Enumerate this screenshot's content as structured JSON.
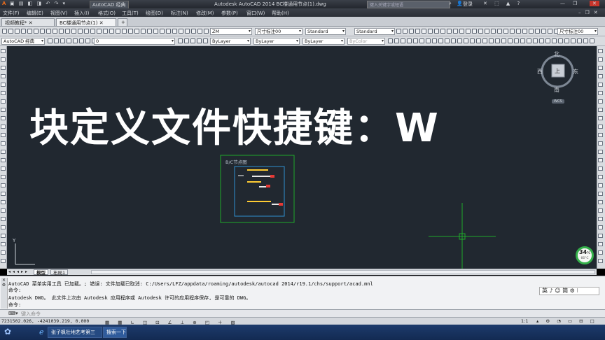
{
  "titlebar": {
    "workspace": "AutoCAD 经典",
    "title": "Autodesk AutoCAD 2014    BC楼通用节点(1).dwg",
    "search_placeholder": "键入关键字或短语",
    "login": "登录",
    "help": "?"
  },
  "menu": [
    "文件(F)",
    "编辑(E)",
    "视图(V)",
    "插入(I)",
    "格式(O)",
    "工具(T)",
    "绘图(D)",
    "标注(N)",
    "修改(M)",
    "参数(P)",
    "窗口(W)",
    "帮助(H)"
  ],
  "doc_tabs": [
    "视频教程*",
    "BC楼通用节点(1)"
  ],
  "toolbars": {
    "workspace": "AutoCAD 经典",
    "layer": "0",
    "textstyle": "ZM",
    "dimstyle": "尺寸标注00",
    "tablestyle": "Standard",
    "mleaderstyle": "Standard",
    "dimstyle2": "尺寸标注00",
    "color": "ByLayer",
    "linetype": "ByLayer",
    "lineweight": "ByColor"
  },
  "overlay_text": "块定义文件快捷键：W",
  "drawing": {
    "block_title": "B/C节点图"
  },
  "viewcube": {
    "north": "北",
    "south": "南",
    "east": "东",
    "west": "西",
    "top": "上",
    "wcs": "WCS"
  },
  "layout_tabs": [
    "模型",
    "布局1"
  ],
  "command_lines": [
    "AutoCAD 菜单实用工具 已加载。; 错误: 文件加载已取消: C:/Users/LFZ/appdata/roaming/autodesk/autocad 2014/r19.1/chs/support/acad.mnl",
    "命令:",
    "Autodesk DWG。  此文件上次由 Autodesk 应用程序或 Autodesk 许可的应用程序保存, 是可靠的 DWG。",
    "命令:"
  ],
  "command_prompt": "键入命令",
  "ime_bar": "英 ♪ ☺ 简 ⚙ ⁝",
  "status": {
    "coords": "7231502.026, -4241039.219, 0.000",
    "scale": "1:1"
  },
  "performance": {
    "percent": "34",
    "temp": "66°C"
  },
  "taskbar": {
    "items": [
      "张子枫壮地艺考第三",
      "搜索一下"
    ]
  },
  "colors": {
    "canvas": "#212830",
    "crosshair": "#1fa82a",
    "block_frame": "#1fa82a",
    "inner_frame": "#2f8fd0"
  }
}
